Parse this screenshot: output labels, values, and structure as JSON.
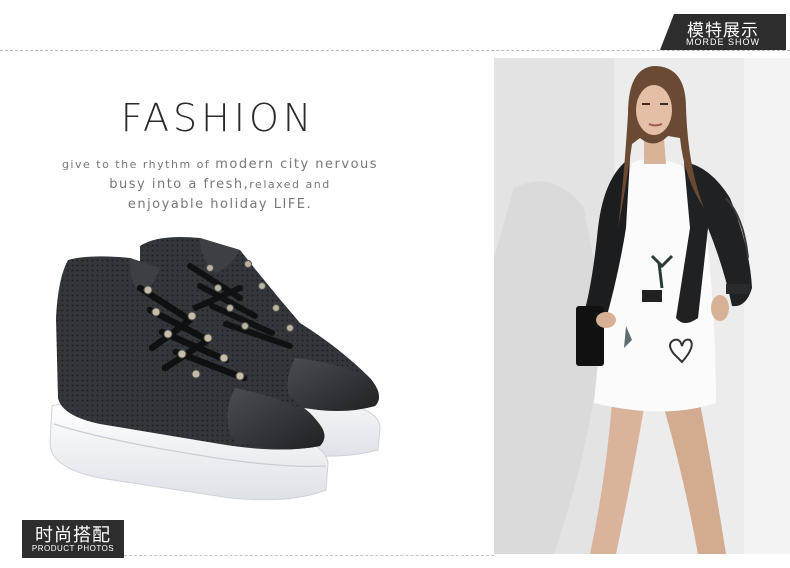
{
  "header_tag": {
    "title": "模特展示",
    "subtitle": "MORDE SHOW"
  },
  "headline": "FASHION",
  "tagline": {
    "line1_small": "give to the rhythm of ",
    "line1_large": "modern city nervous",
    "line2_large": "busy into a fresh,",
    "line2_small": "relaxed and",
    "line3": "enjoyable holiday LIFE."
  },
  "footer_tag": {
    "title": "时尚搭配",
    "subtitle": "PRODUCT PHOTOS"
  },
  "images": {
    "product": "black-perforated-leather-high-top-platform-sneakers",
    "model": "model-in-white-dress-and-black-bomber-jacket"
  },
  "colors": {
    "tag_background": "#2d2d2d",
    "shoe_leather": "#2f3236",
    "sole": "#f2f3f7"
  }
}
